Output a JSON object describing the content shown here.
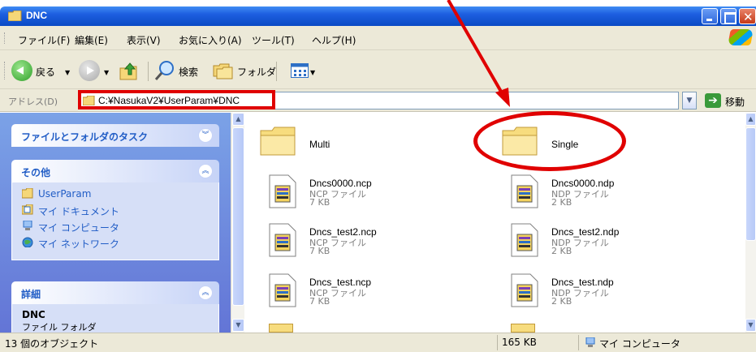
{
  "window": {
    "title": "DNC"
  },
  "menu": {
    "items": [
      "ファイル(F)",
      "編集(E)",
      "表示(V)",
      "お気に入り(A)",
      "ツール(T)",
      "ヘルプ(H)"
    ]
  },
  "toolbar": {
    "back_label": "戻る",
    "search_label": "検索",
    "folders_label": "フォルダ"
  },
  "address": {
    "label": "アドレス(D)",
    "value": "C:¥NasukaV2¥UserParam¥DNC",
    "go_label": "移動"
  },
  "sidebar": {
    "tasks_header": "ファイルとフォルダのタスク",
    "other_header": "その他",
    "other_items": [
      "UserParam",
      "マイ ドキュメント",
      "マイ コンピュータ",
      "マイ ネットワーク"
    ],
    "details_header": "詳細",
    "details_name": "DNC",
    "details_type": "ファイル フォルダ"
  },
  "files": [
    {
      "name": "Multi",
      "kind": "folder"
    },
    {
      "name": "Single",
      "kind": "folder"
    },
    {
      "name": "Dncs0000.ncp",
      "type": "NCP ファイル",
      "size": "7 KB",
      "kind": "file"
    },
    {
      "name": "Dncs0000.ndp",
      "type": "NDP ファイル",
      "size": "2 KB",
      "kind": "file"
    },
    {
      "name": "Dncs_test2.ncp",
      "type": "NCP ファイル",
      "size": "7 KB",
      "kind": "file"
    },
    {
      "name": "Dncs_test2.ndp",
      "type": "NDP ファイル",
      "size": "2 KB",
      "kind": "file"
    },
    {
      "name": "Dncs_test.ncp",
      "type": "NCP ファイル",
      "size": "7 KB",
      "kind": "file"
    },
    {
      "name": "Dncs_test.ndp",
      "type": "NDP ファイル",
      "size": "2 KB",
      "kind": "file"
    }
  ],
  "status": {
    "count": "13 個のオブジェクト",
    "size": "165 KB",
    "location": "マイ コンピュータ"
  },
  "colors": {
    "annotation": "#e00000",
    "titlebar": "#0a4ac4",
    "task_text": "#215dc6"
  }
}
